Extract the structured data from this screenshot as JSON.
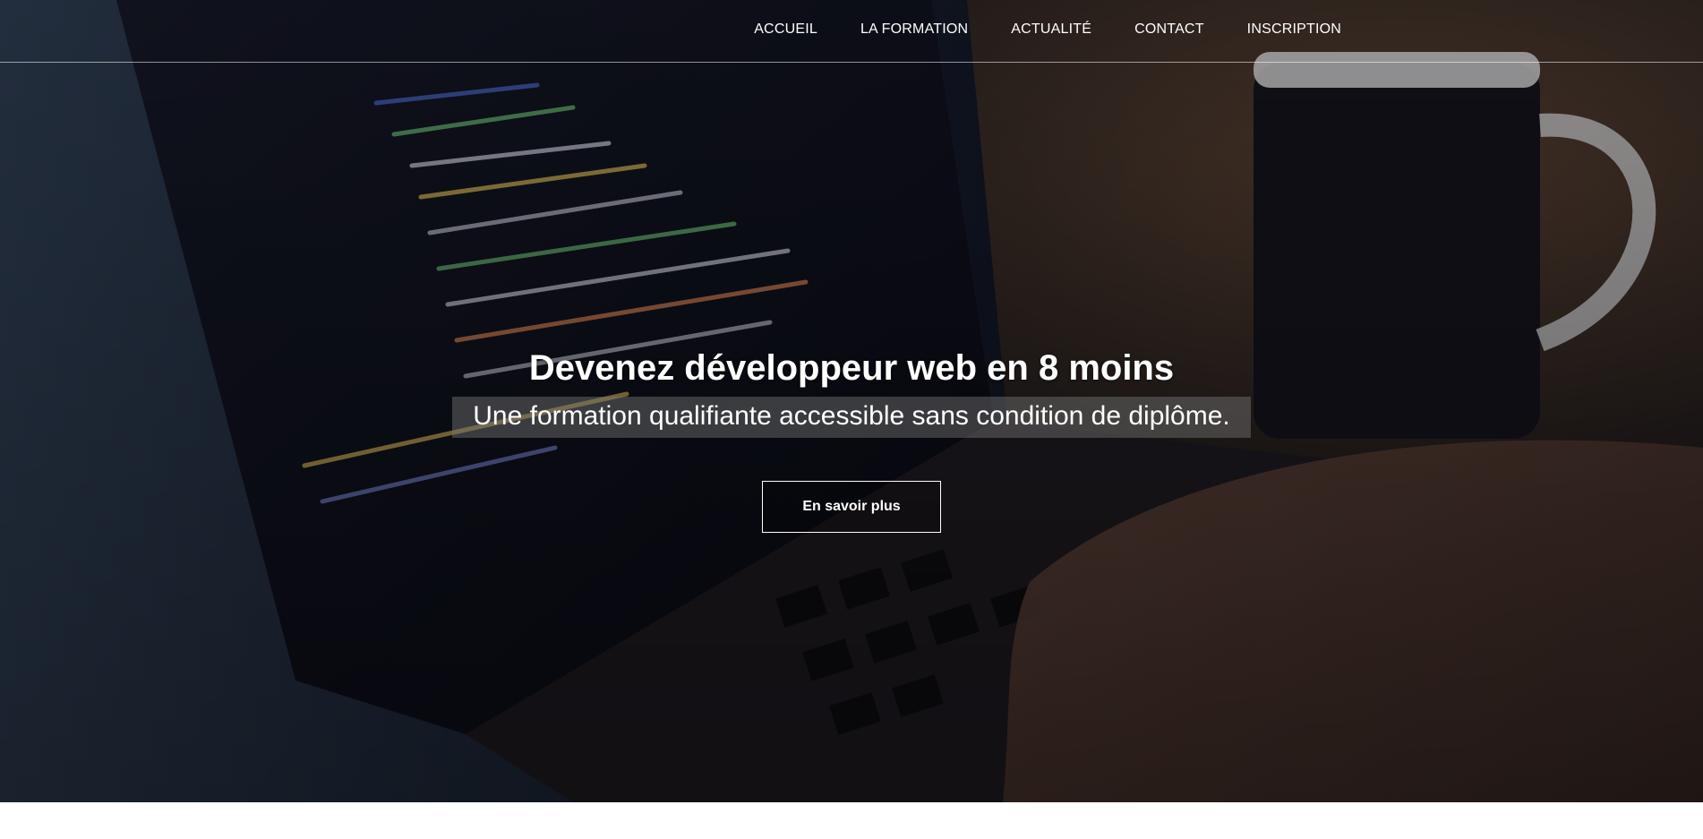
{
  "nav": {
    "items": [
      {
        "label": "ACCUEIL"
      },
      {
        "label": "LA FORMATION"
      },
      {
        "label": "ACTUALITÉ"
      },
      {
        "label": "CONTACT"
      },
      {
        "label": "INSCRIPTION"
      }
    ]
  },
  "hero": {
    "title": "Devenez développeur web en 8 moins",
    "subtitle": "Une formation qualifiante accessible sans condition de diplôme.",
    "cta_label": "En savoir plus",
    "background_image": "laptop-code-coffee-mug-photo"
  },
  "colors": {
    "overlay": "#0c0e18",
    "text": "#ffffff",
    "subtitle_band": "#787878"
  }
}
